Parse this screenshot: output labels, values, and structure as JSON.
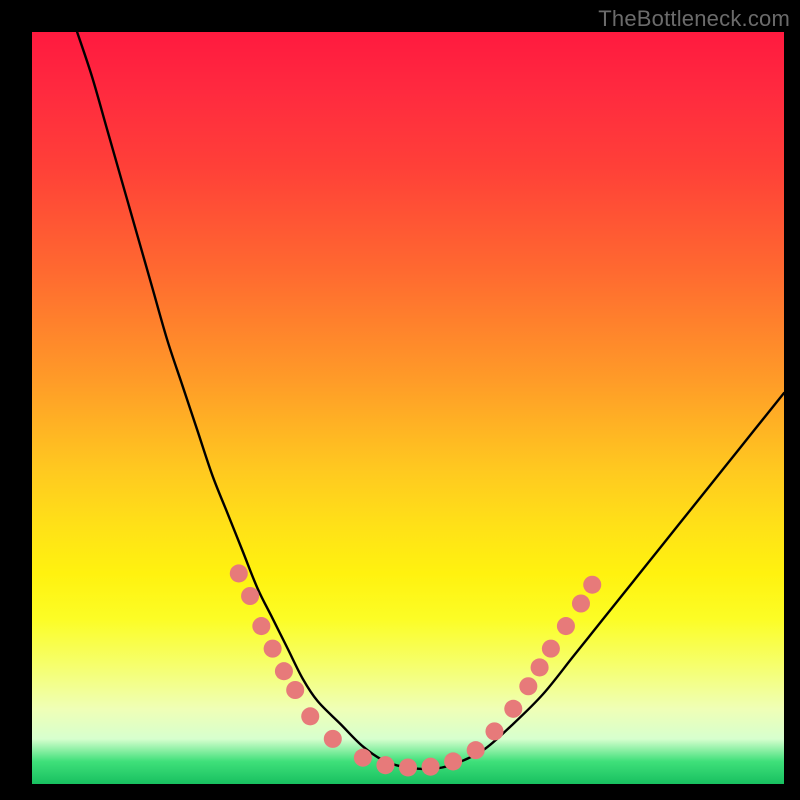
{
  "watermark": "TheBottleneck.com",
  "chart_data": {
    "type": "line",
    "title": "",
    "xlabel": "",
    "ylabel": "",
    "xlim": [
      0,
      100
    ],
    "ylim": [
      0,
      100
    ],
    "grid": false,
    "series": [
      {
        "name": "bottleneck-curve",
        "color": "#000000",
        "x": [
          6,
          8,
          10,
          12,
          14,
          16,
          18,
          20,
          22,
          24,
          26,
          28,
          30,
          32,
          34,
          36,
          38,
          41,
          44,
          47,
          50,
          53,
          56,
          60,
          64,
          68,
          72,
          76,
          80,
          84,
          88,
          92,
          96,
          100
        ],
        "y": [
          100,
          94,
          87,
          80,
          73,
          66,
          59,
          53,
          47,
          41,
          36,
          31,
          26,
          22,
          18,
          14,
          11,
          8,
          5,
          3,
          2.2,
          2,
          2.6,
          4.5,
          8,
          12,
          17,
          22,
          27,
          32,
          37,
          42,
          47,
          52
        ]
      }
    ],
    "markers": {
      "name": "highlight-dots",
      "color": "#e77a7a",
      "radius_pct": 1.2,
      "points": [
        {
          "x": 27.5,
          "y": 28
        },
        {
          "x": 29,
          "y": 25
        },
        {
          "x": 30.5,
          "y": 21
        },
        {
          "x": 32,
          "y": 18
        },
        {
          "x": 33.5,
          "y": 15
        },
        {
          "x": 35,
          "y": 12.5
        },
        {
          "x": 37,
          "y": 9
        },
        {
          "x": 40,
          "y": 6
        },
        {
          "x": 44,
          "y": 3.5
        },
        {
          "x": 47,
          "y": 2.5
        },
        {
          "x": 50,
          "y": 2.2
        },
        {
          "x": 53,
          "y": 2.3
        },
        {
          "x": 56,
          "y": 3
        },
        {
          "x": 59,
          "y": 4.5
        },
        {
          "x": 61.5,
          "y": 7
        },
        {
          "x": 64,
          "y": 10
        },
        {
          "x": 66,
          "y": 13
        },
        {
          "x": 67.5,
          "y": 15.5
        },
        {
          "x": 69,
          "y": 18
        },
        {
          "x": 71,
          "y": 21
        },
        {
          "x": 73,
          "y": 24
        },
        {
          "x": 74.5,
          "y": 26.5
        }
      ]
    }
  }
}
